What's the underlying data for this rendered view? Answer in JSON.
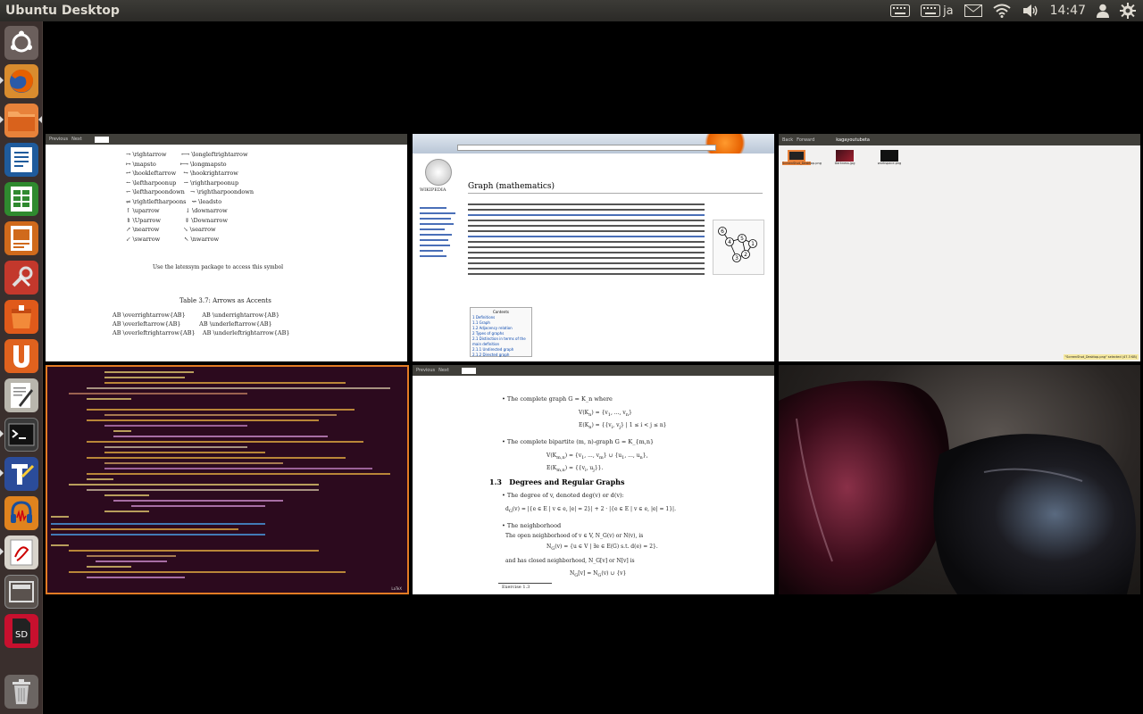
{
  "panel": {
    "title": "Ubuntu Desktop",
    "keyboard_lang": "ja",
    "clock": "14:47"
  },
  "launcher": {
    "items": [
      {
        "icon": "dash-home-icon"
      },
      {
        "icon": "firefox-icon"
      },
      {
        "icon": "files-icon"
      },
      {
        "icon": "writer-icon"
      },
      {
        "icon": "calc-icon"
      },
      {
        "icon": "impress-icon"
      },
      {
        "icon": "settings-icon"
      },
      {
        "icon": "install-icon"
      },
      {
        "icon": "ubuntu-one-icon"
      },
      {
        "icon": "text-editor-icon"
      },
      {
        "icon": "terminal-icon"
      },
      {
        "icon": "texmaker-icon"
      },
      {
        "icon": "audacity-icon"
      },
      {
        "icon": "evince-icon"
      },
      {
        "icon": "workspace-switcher-icon"
      },
      {
        "icon": "sd-card-icon"
      },
      {
        "icon": "trash-icon"
      }
    ]
  },
  "windows": {
    "evince_arrows": {
      "toolbar": [
        "Previous",
        "Next"
      ],
      "table_caption": "Table 3.7: Arrows as Accents",
      "footnote": "Use the latexsym package to access this symbol"
    },
    "firefox": {
      "heading": "Graph (mathematics)",
      "site": "WIKIPEDIA",
      "contents_label": "Contents",
      "contents": [
        "1 Definitions",
        "1.1 Graph",
        "1.2 Adjacency relation",
        "2 Types of graphs",
        "2.1 Distinction in terms of the main definition",
        "2.1.1 Undirected graph",
        "2.1.2 Directed graph",
        "2.1.3 Mixed graph"
      ],
      "graph_nodes": [
        "6",
        "4",
        "5",
        "1",
        "3",
        "2"
      ]
    },
    "file_browser": {
      "toolbar": [
        "Back",
        "Forward"
      ],
      "path": "kagayoutubeta",
      "files": [
        "ScreenShot_Desktop.png",
        "Darkness.jpg",
        "workspace.png"
      ],
      "status": "\"ScreenShot_Desktop.png\" selected (47.3 KB)"
    },
    "editor": {
      "status": "LaTeX"
    },
    "evince_graph": {
      "toolbar": [
        "Previous",
        "Next"
      ],
      "section_number": "1.3",
      "section_title": "Degrees and Regular Graphs",
      "items": [
        "The complete graph G = K_n where",
        "The complete bipartite (m, n)-graph G = K_{m,n}",
        "The degree of v, denoted deg(v) or d(v):",
        "The neighborhood",
        "The open neighborhood of v ∈ V, N_G(v) or N(v), is",
        "and has closed neighborhood, N_G[v] or N[v] is"
      ],
      "footnote": "Exercise 1.3"
    },
    "wallpaper": {
      "theme": "dark wine glass"
    }
  },
  "colors": {
    "panel": "#3c3b37",
    "launcher": "#3a2f2d",
    "terminal_bg": "#2c0a1e",
    "active_border": "#e37b24",
    "firefox_orange": "#e66000"
  }
}
